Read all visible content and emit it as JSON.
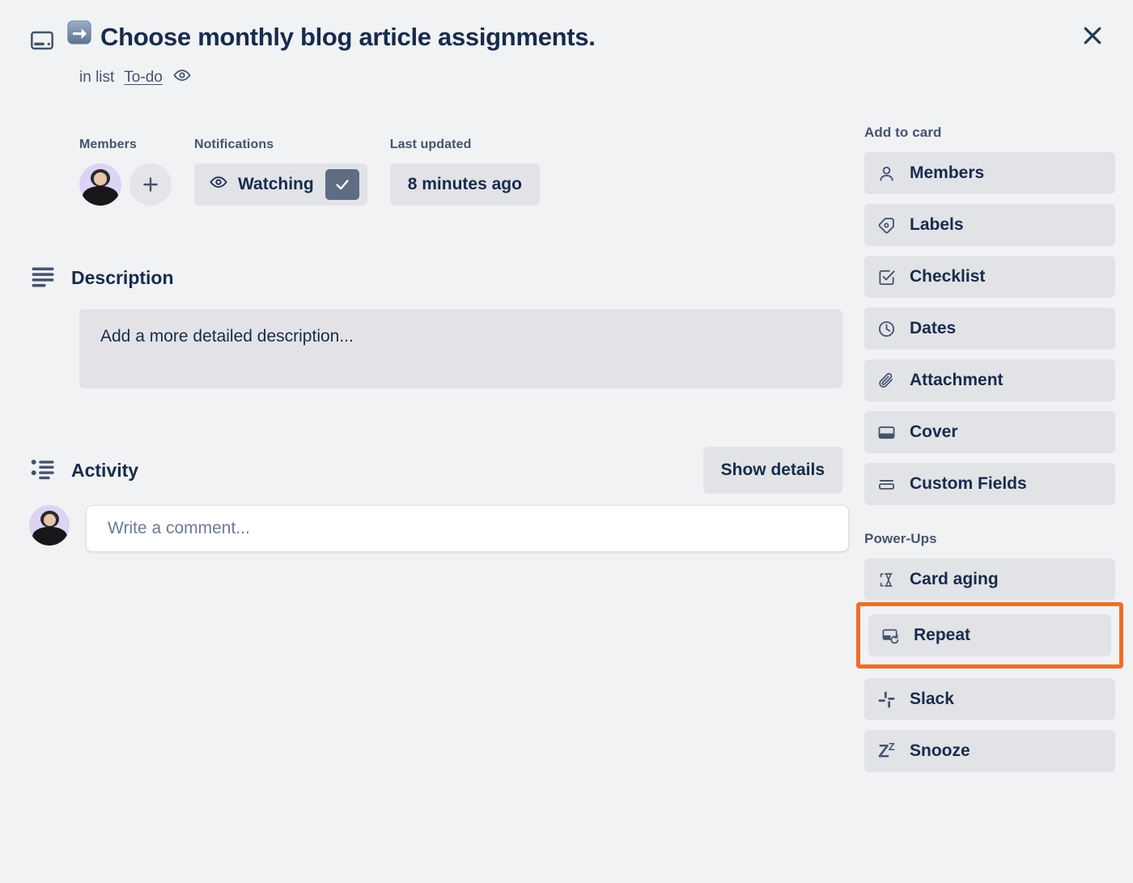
{
  "window": {
    "close_label": "×"
  },
  "card": {
    "emoji": "➡️",
    "title": "Choose monthly blog article assignments.",
    "in_list_prefix": "in list",
    "list_name": "To-do",
    "card_icon_name": "card-cover-icon",
    "watch_icon_name": "eye-icon"
  },
  "meta": {
    "members_label": "Members",
    "notifications_label": "Notifications",
    "last_updated_label": "Last updated",
    "watching_text": "Watching",
    "last_updated_value": "8 minutes ago",
    "add_member_glyph": "+"
  },
  "description": {
    "heading": "Description",
    "placeholder": "Add a more detailed description..."
  },
  "activity": {
    "heading": "Activity",
    "show_details_label": "Show details",
    "comment_placeholder": "Write a comment..."
  },
  "sidebar": {
    "add_to_card_title": "Add to card",
    "add_to_card_items": [
      {
        "label": "Members",
        "icon": "person-icon"
      },
      {
        "label": "Labels",
        "icon": "tag-icon"
      },
      {
        "label": "Checklist",
        "icon": "checkbox-icon"
      },
      {
        "label": "Dates",
        "icon": "clock-icon"
      },
      {
        "label": "Attachment",
        "icon": "paperclip-icon"
      },
      {
        "label": "Cover",
        "icon": "cover-icon"
      },
      {
        "label": "Custom Fields",
        "icon": "custom-fields-icon"
      }
    ],
    "power_ups_title": "Power-Ups",
    "power_ups_items": [
      {
        "label": "Card aging",
        "icon": "hourglass-icon"
      },
      {
        "label": "Repeat",
        "icon": "repeat-icon"
      },
      {
        "label": "Slack",
        "icon": "slack-icon"
      },
      {
        "label": "Snooze",
        "icon": "snooze-zz-icon"
      }
    ],
    "highlighted_item": "Repeat"
  },
  "colors": {
    "background": "#f1f2f4",
    "panel": "#e2e3e7",
    "text": "#172b4d",
    "muted_text": "#44546f",
    "highlight": "#ef6c2a",
    "checkbox": "#5e6c84",
    "avatar_bg": "#dcd3f5"
  }
}
